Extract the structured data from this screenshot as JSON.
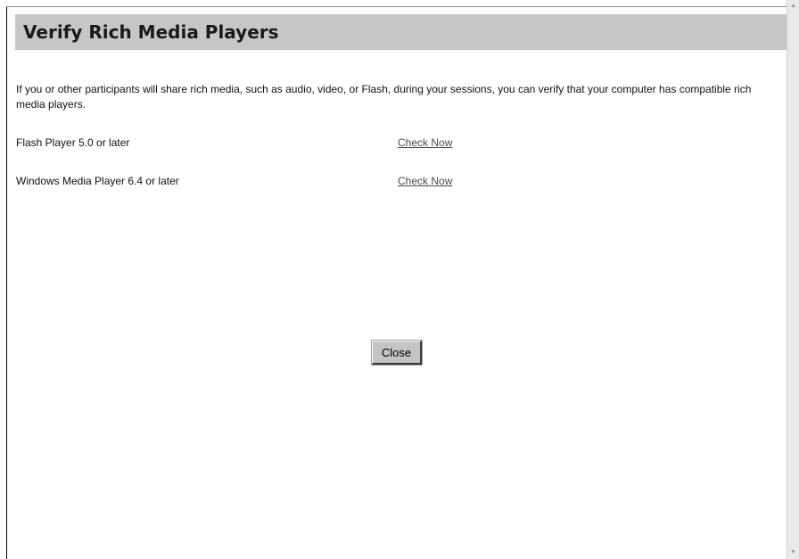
{
  "dialog": {
    "title": "Verify Rich Media Players",
    "intro_text": "If you or other participants will share rich media, such as audio, video, or Flash, during your sessions, you can verify that your computer has compatible rich media players.",
    "players": [
      {
        "name": "Flash Player 5.0 or later",
        "link_label": "Check Now"
      },
      {
        "name": "Windows Media Player 6.4 or later",
        "link_label": "Check Now"
      }
    ],
    "close_label": "Close"
  },
  "scrollbar": {
    "up_glyph": "▲",
    "down_glyph": "▼"
  },
  "colors": {
    "title_bar": "#c6c6c6",
    "link": "#4a4a4a",
    "button_face": "#c4c4c4"
  }
}
